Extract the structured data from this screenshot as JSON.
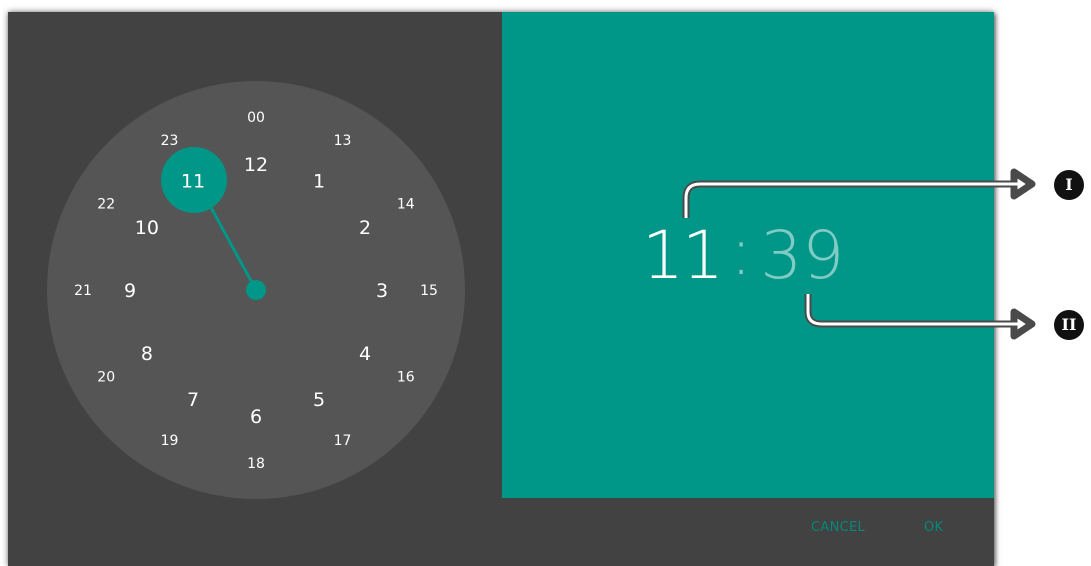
{
  "time_picker": {
    "hour": "11",
    "separator": ":",
    "minute": "39",
    "selected_hour": "11",
    "cancel_label": "CANCEL",
    "ok_label": "OK",
    "outer_ring_labels": [
      "12",
      "1",
      "2",
      "3",
      "4",
      "5",
      "6",
      "7",
      "8",
      "9",
      "10",
      "11"
    ],
    "inner_ring_labels": [
      "00",
      "13",
      "14",
      "15",
      "16",
      "17",
      "18",
      "19",
      "20",
      "21",
      "22",
      "23"
    ],
    "colors": {
      "accent": "#009688",
      "dialog_background": "#424242",
      "clock_face": "#555555",
      "unselected_minute": "#80cbc4",
      "button_text": "#00897b"
    }
  },
  "callouts": {
    "hour_marker": "I",
    "minute_marker": "II"
  }
}
